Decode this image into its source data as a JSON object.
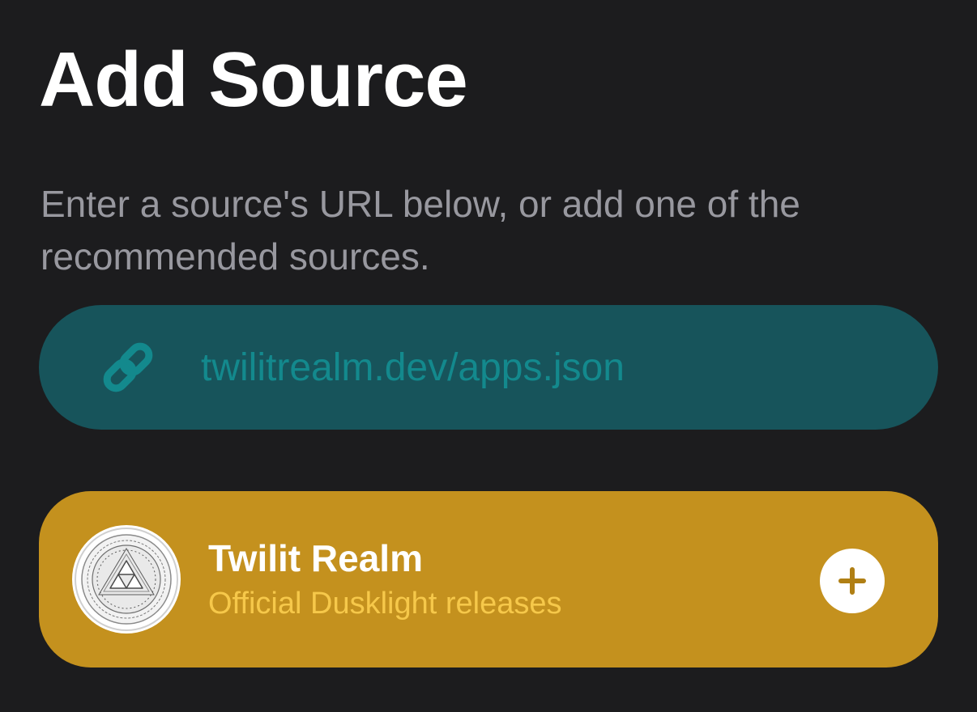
{
  "header": {
    "title": "Add Source",
    "description": "Enter a source's URL below, or add one of the recommended sources."
  },
  "url_field": {
    "icon": "link-icon",
    "placeholder": "twilitrealm.dev/apps.json",
    "value": ""
  },
  "recommended_sources": [
    {
      "name": "Twilit Realm",
      "subtitle": "Official Dusklight releases",
      "logo": "triforce-seal-logo",
      "action_icon": "plus-icon",
      "card_color": "#c4911e",
      "subtitle_color": "#f6c84a"
    }
  ],
  "colors": {
    "background": "#1c1c1e",
    "title": "#ffffff",
    "description": "#98989f",
    "url_field_bg": "#17545b",
    "url_accent": "#13898d"
  }
}
